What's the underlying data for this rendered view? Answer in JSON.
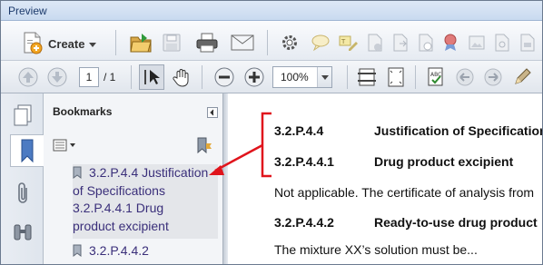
{
  "window": {
    "title": "Preview"
  },
  "toolbar": {
    "create_label": "Create",
    "page_current": "1",
    "page_total": "/ 1",
    "zoom": "100%"
  },
  "bookmarks": {
    "title": "Bookmarks",
    "items": [
      {
        "lines": [
          "3.2.P.4.4 Justification",
          "of Specifications",
          "3.2.P.4.4.1 Drug",
          "product excipient"
        ]
      },
      {
        "lines": [
          "3.2.P.4.4.2"
        ]
      }
    ]
  },
  "document": {
    "rows": [
      {
        "number": "3.2.P.4.4",
        "heading": "Justification of Specifications"
      },
      {
        "number": "3.2.P.4.4.1",
        "heading": "Drug product excipient"
      }
    ],
    "paragraph1": "Not applicable. The certificate of analysis from",
    "row3": {
      "number": "3.2.P.4.4.2",
      "heading": "Ready-to-use drug product"
    },
    "paragraph2": "The mixture XX’s solution must be..."
  },
  "colors": {
    "annotation": "#e0141c",
    "bookmark_text": "#3a2f7a"
  }
}
